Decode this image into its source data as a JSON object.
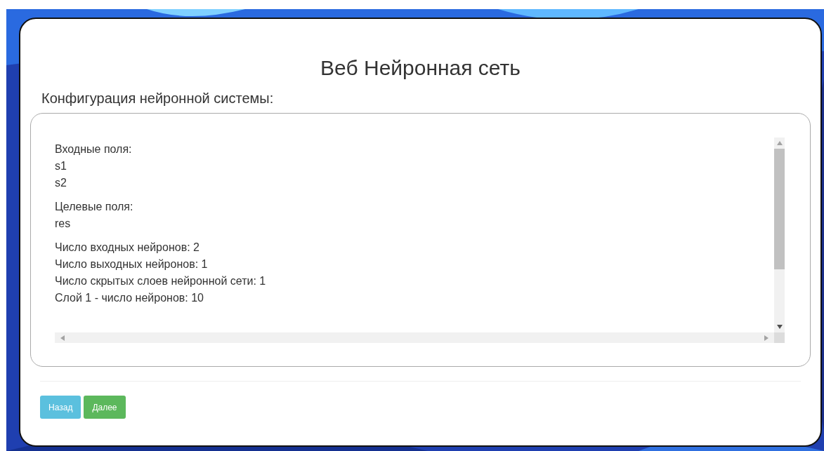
{
  "title": "Веб Нейронная сеть",
  "section_heading": "Конфигурация нейронной системы:",
  "config_groups": [
    {
      "lines": [
        "Входные поля:",
        "s1",
        "s2"
      ]
    },
    {
      "lines": [
        "Целевые поля:",
        "res"
      ]
    },
    {
      "lines": [
        "Число входных нейронов: 2",
        "Число выходных нейронов: 1",
        "Число скрытых слоев нейронной сети: 1",
        "Слой 1 - число нейронов: 10"
      ]
    }
  ],
  "buttons": [
    {
      "label": "Назад",
      "kind": "info"
    },
    {
      "label": "Далее",
      "kind": "success"
    }
  ]
}
